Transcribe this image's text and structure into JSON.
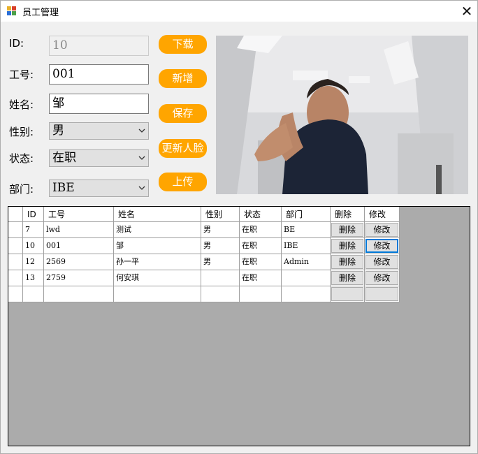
{
  "window": {
    "title": "员工管理",
    "close_glyph": "✕"
  },
  "form": {
    "id_label": "ID:",
    "id_value": "10",
    "empno_label": "工号:",
    "empno_value": "001",
    "name_label": "姓名:",
    "name_value": "邹",
    "gender_label": "性别:",
    "gender_value": "男",
    "status_label": "状态:",
    "status_value": "在职",
    "dept_label": "部门:",
    "dept_value": "IBE"
  },
  "buttons": {
    "download": "下载",
    "add": "新增",
    "save": "保存",
    "update_face": "更新人脸",
    "upload": "上传"
  },
  "colors": {
    "accent": "#ffa500",
    "grid_background": "#ababab",
    "focus": "#0078d7"
  },
  "camera": {
    "icon": "camera-preview-photo"
  },
  "grid": {
    "headers": [
      "ID",
      "工号",
      "姓名",
      "性别",
      "状态",
      "部门",
      "删除",
      "修改"
    ],
    "rows": [
      {
        "id": "7",
        "empno": "lwd",
        "name": "测试",
        "gender": "男",
        "status": "在职",
        "dept": "BE",
        "delete": "删除",
        "edit": "修改"
      },
      {
        "id": "10",
        "empno": "001",
        "name": "邹",
        "gender": "男",
        "status": "在职",
        "dept": "IBE",
        "delete": "删除",
        "edit": "修改"
      },
      {
        "id": "12",
        "empno": "2569",
        "name": "孙一平",
        "gender": "男",
        "status": "在职",
        "dept": "Admin",
        "delete": "删除",
        "edit": "修改"
      },
      {
        "id": "13",
        "empno": "2759",
        "name": "何安琪",
        "gender": "",
        "status": "在职",
        "dept": "",
        "delete": "删除",
        "edit": "修改"
      }
    ]
  }
}
